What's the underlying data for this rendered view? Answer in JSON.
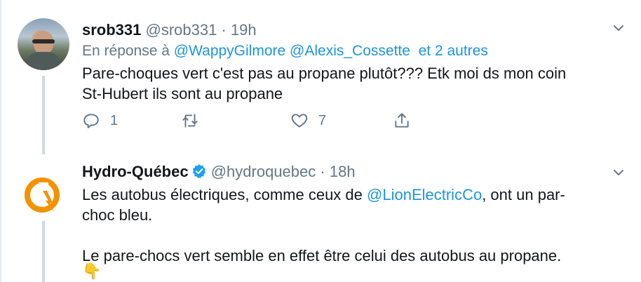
{
  "tweets": [
    {
      "name": "srob331",
      "handle": "@srob331",
      "separator": "·",
      "time": "19h",
      "reply_prefix": "En réponse à",
      "reply_mentions": [
        "@WappyGilmore",
        "@Alexis_Cossette"
      ],
      "reply_others": "et 2 autres",
      "text_line1": "Pare-choques vert c'est pas au propane plutôt??? Etk moi ds mon coin",
      "text_line2": "St-Hubert ils sont au propane",
      "actions": {
        "reply_count": "1",
        "retweet_count": "",
        "like_count": "7"
      },
      "avatar": "profile-photo"
    },
    {
      "name": "Hydro-Québec",
      "verified": true,
      "handle": "@hydroquebec",
      "separator": "·",
      "time": "18h",
      "text_pre_link": "Les autobus électriques, comme ceux de ",
      "link": "@LionElectricCo",
      "text_post_link": ", ont un par-",
      "text_line2": "choc bleu.",
      "text_para2": "Le pare-chocs vert semble en effet être celui des autobus au propane.",
      "emoji": "👇",
      "avatar": "hydro-quebec-logo"
    }
  ],
  "colors": {
    "link": "#1b95e0",
    "muted": "#657786",
    "thread_line": "#cfd9de",
    "hq_orange": "#f39200"
  },
  "icons": [
    "reply-icon",
    "retweet-icon",
    "like-icon",
    "share-icon",
    "chevron-down-icon",
    "verified-badge-icon"
  ]
}
